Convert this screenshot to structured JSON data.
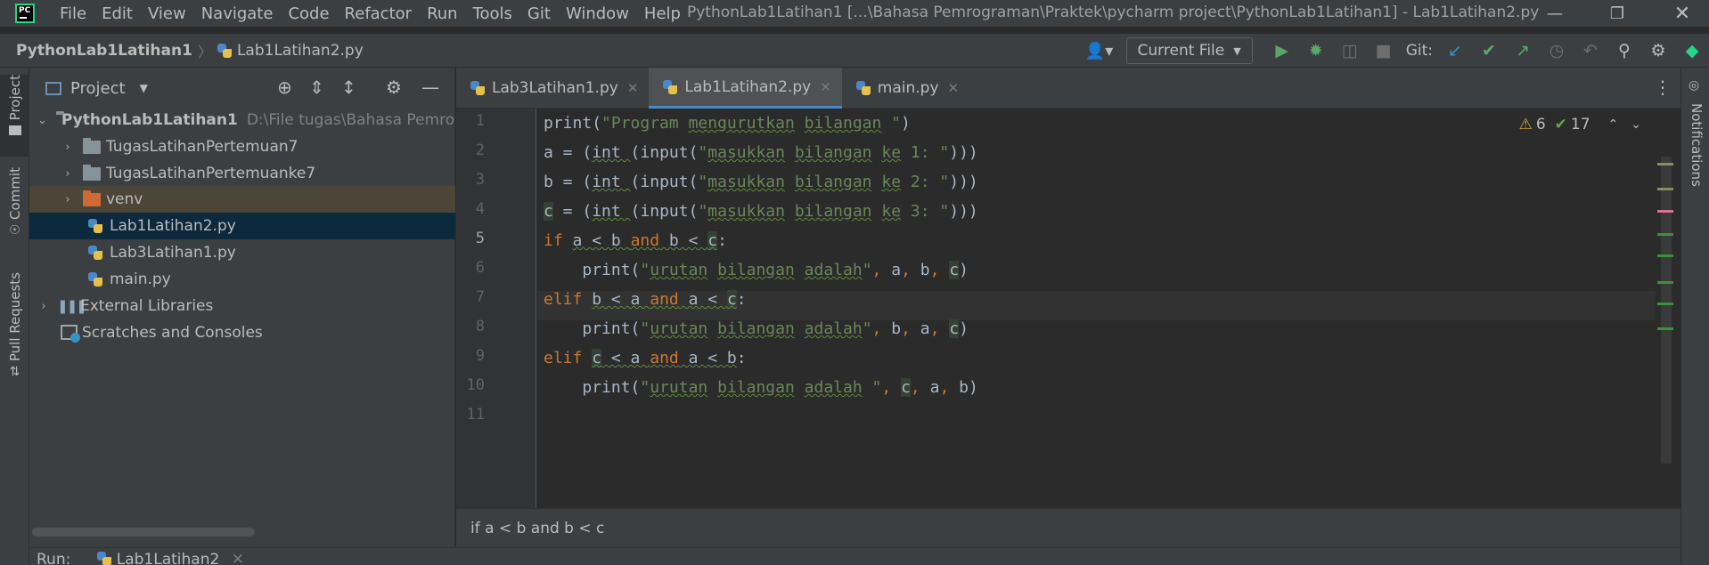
{
  "menubar": {
    "items": [
      "File",
      "Edit",
      "View",
      "Navigate",
      "Code",
      "Refactor",
      "Run",
      "Tools",
      "Git",
      "Window",
      "Help"
    ],
    "window_title": "PythonLab1Latihan1 [...\\Bahasa Pemrograman\\Praktek\\pycharm project\\PythonLab1Latihan1] - Lab1Latihan2.py"
  },
  "navbar": {
    "project": "PythonLab1Latihan1",
    "file": "Lab1Latihan2.py",
    "run_config": "Current File",
    "git_label": "Git:"
  },
  "left_strip": {
    "project": "Project",
    "commit": "Commit",
    "pull_requests": "Pull Requests"
  },
  "right_strip": {
    "notifications": "Notifications"
  },
  "project_panel": {
    "title": "Project",
    "tree": [
      {
        "label": "PythonLab1Latihan1",
        "hint": "D:\\File tugas\\Bahasa Pemrog"
      },
      {
        "label": "TugasLatihanPertemuan7"
      },
      {
        "label": "TugasLatihanPertemuanke7"
      },
      {
        "label": "venv"
      },
      {
        "label": "Lab1Latihan2.py"
      },
      {
        "label": "Lab3Latihan1.py"
      },
      {
        "label": "main.py"
      },
      {
        "label": "External Libraries"
      },
      {
        "label": "Scratches and Consoles"
      }
    ]
  },
  "editor": {
    "tabs": [
      "Lab3Latihan1.py",
      "Lab1Latihan2.py",
      "main.py"
    ],
    "active_tab": "Lab1Latihan2.py",
    "line_numbers": [
      "1",
      "2",
      "3",
      "4",
      "5",
      "6",
      "7",
      "8",
      "9",
      "10",
      "11"
    ],
    "current_line": 5,
    "warnings": "6",
    "weak_warnings": "17",
    "breadcrumb": "if a < b and b < c"
  },
  "runbar": {
    "label": "Run:",
    "config": "Lab1Latihan2"
  }
}
